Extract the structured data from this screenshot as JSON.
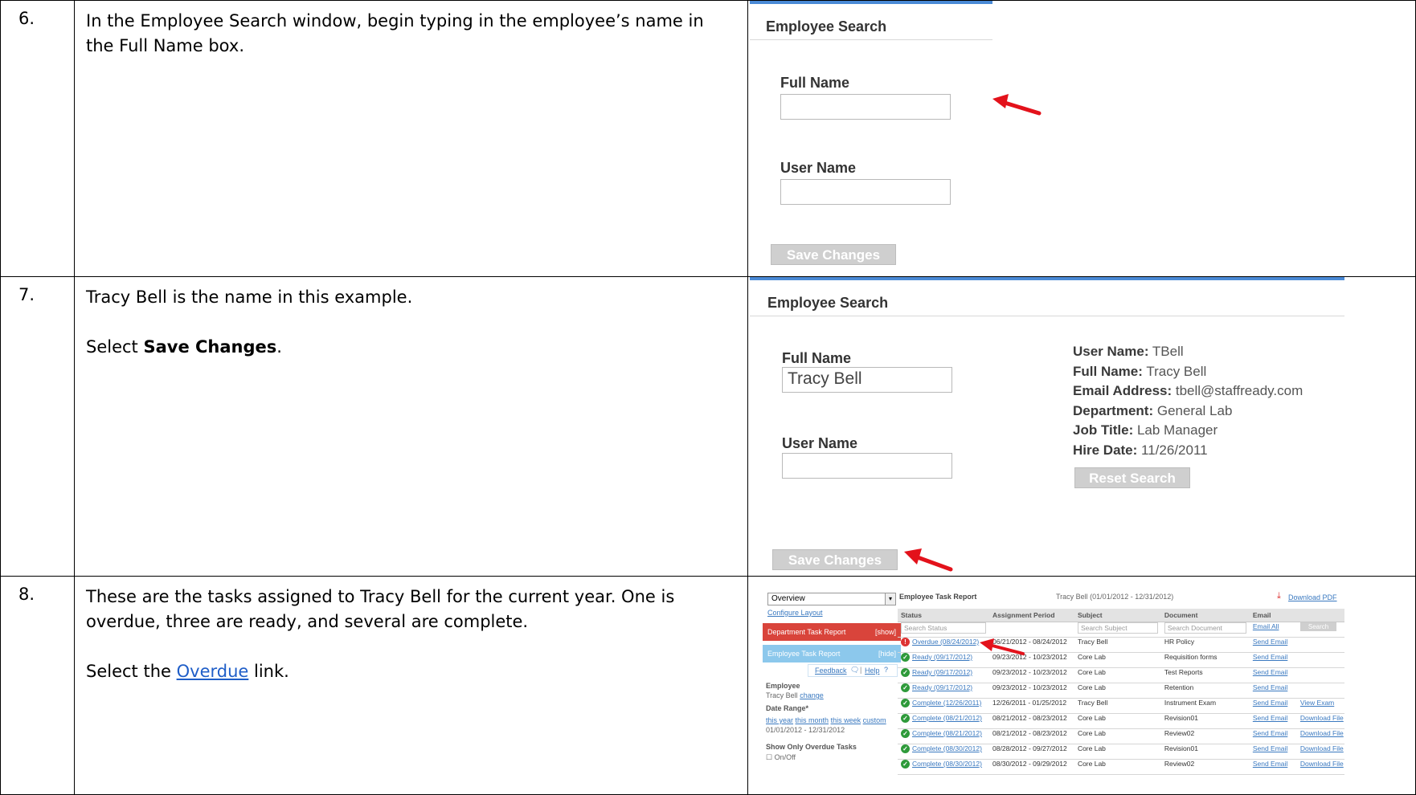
{
  "rows": [
    {
      "number": "6.",
      "paragraphs": [
        "In the Employee Search window, begin typing in the employee’s name in the Full Name box."
      ],
      "screenshot": {
        "title": "Employee Search",
        "full_name_label": "Full Name",
        "full_name_value": "",
        "user_name_label": "User Name",
        "user_name_value": "",
        "save_label": "Save Changes"
      }
    },
    {
      "number": "7.",
      "paragraph1": "Tracy Bell is the name in this example.",
      "paragraph2_prefix": "Select ",
      "paragraph2_bold": "Save Changes",
      "paragraph2_suffix": ".",
      "screenshot": {
        "title": "Employee Search",
        "full_name_label": "Full Name",
        "full_name_value": "Tracy Bell",
        "user_name_label": "User Name",
        "user_name_value": "",
        "save_label": "Save Changes",
        "reset_label": "Reset Search",
        "details": [
          {
            "label": "User Name:",
            "value": " TBell"
          },
          {
            "label": "Full Name:",
            "value": " Tracy Bell"
          },
          {
            "label": "Email Address:",
            "value": " tbell@staffready.com"
          },
          {
            "label": "Department:",
            "value": " General Lab"
          },
          {
            "label": "Job Title:",
            "value": " Lab Manager"
          },
          {
            "label": "Hire Date:",
            "value": " 11/26/2011"
          }
        ]
      }
    },
    {
      "number": "8.",
      "paragraph1": "These are the tasks assigned to Tracy Bell for the current year.  One is overdue, three are ready, and several are complete.",
      "paragraph2_prefix": "Select the ",
      "paragraph2_link": "Overdue",
      "paragraph2_suffix": " link.",
      "screenshot": {
        "overview_select": "Overview",
        "configure_layout": "Configure Layout",
        "dept_report": "Department Task Report",
        "dept_show": "[show]",
        "emp_report": "Employee Task Report",
        "emp_hide": "[hide]",
        "feedback": "Feedback",
        "help": "Help",
        "employee_label": "Employee",
        "employee_value": "Tracy Bell",
        "change": "change",
        "date_range_label": "Date Range*",
        "ranges": [
          "this year",
          "this month",
          "this week",
          "custom"
        ],
        "date_range_value": "01/01/2012 - 12/31/2012",
        "overdue_only_label": "Show Only Overdue Tasks",
        "onoff": "On/Off",
        "report_title": "Employee Task Report",
        "report_subtitle": "Tracy Bell (01/01/2012 - 12/31/2012)",
        "download_pdf": "Download PDF",
        "columns": [
          "Status",
          "Assignment Period",
          "Subject",
          "Document",
          "Email",
          ""
        ],
        "search": {
          "status": "Search Status",
          "subject": "Search Subject",
          "document": "Search Document",
          "email_all": "Email All",
          "button": "Search"
        },
        "tasks": [
          {
            "status": "Overdue (08/24/2012)",
            "kind": "bad",
            "period": "06/21/2012 - 08/24/2012",
            "subject": "Tracy Bell",
            "document": "HR Policy",
            "email": "Send Email",
            "extra": ""
          },
          {
            "status": "Ready (09/17/2012)",
            "kind": "ok",
            "period": "09/23/2012 - 10/23/2012",
            "subject": "Core Lab",
            "document": "Requisition forms",
            "email": "Send Email",
            "extra": ""
          },
          {
            "status": "Ready (09/17/2012)",
            "kind": "ok",
            "period": "09/23/2012 - 10/23/2012",
            "subject": "Core Lab",
            "document": "Test Reports",
            "email": "Send Email",
            "extra": ""
          },
          {
            "status": "Ready (09/17/2012)",
            "kind": "ok",
            "period": "09/23/2012 - 10/23/2012",
            "subject": "Core Lab",
            "document": "Retention",
            "email": "Send Email",
            "extra": ""
          },
          {
            "status": "Complete (12/26/2011)",
            "kind": "ok",
            "period": "12/26/2011 - 01/25/2012",
            "subject": "Tracy Bell",
            "document": "Instrument Exam",
            "email": "Send Email",
            "extra": "View Exam"
          },
          {
            "status": "Complete (08/21/2012)",
            "kind": "ok",
            "period": "08/21/2012 - 08/23/2012",
            "subject": "Core Lab",
            "document": "Revision01",
            "email": "Send Email",
            "extra": "Download File"
          },
          {
            "status": "Complete (08/21/2012)",
            "kind": "ok",
            "period": "08/21/2012 - 08/23/2012",
            "subject": "Core Lab",
            "document": "Review02",
            "email": "Send Email",
            "extra": "Download File"
          },
          {
            "status": "Complete (08/30/2012)",
            "kind": "ok",
            "period": "08/28/2012 - 09/27/2012",
            "subject": "Core Lab",
            "document": "Revision01",
            "email": "Send Email",
            "extra": "Download File"
          },
          {
            "status": "Complete (08/30/2012)",
            "kind": "ok",
            "period": "08/30/2012 - 09/29/2012",
            "subject": "Core Lab",
            "document": "Review02",
            "email": "Send Email",
            "extra": "Download File"
          }
        ]
      }
    }
  ],
  "colors": {
    "arrow": "#e3121b",
    "link": "#1f5ec8",
    "header_bar": "#4a8ad6"
  }
}
